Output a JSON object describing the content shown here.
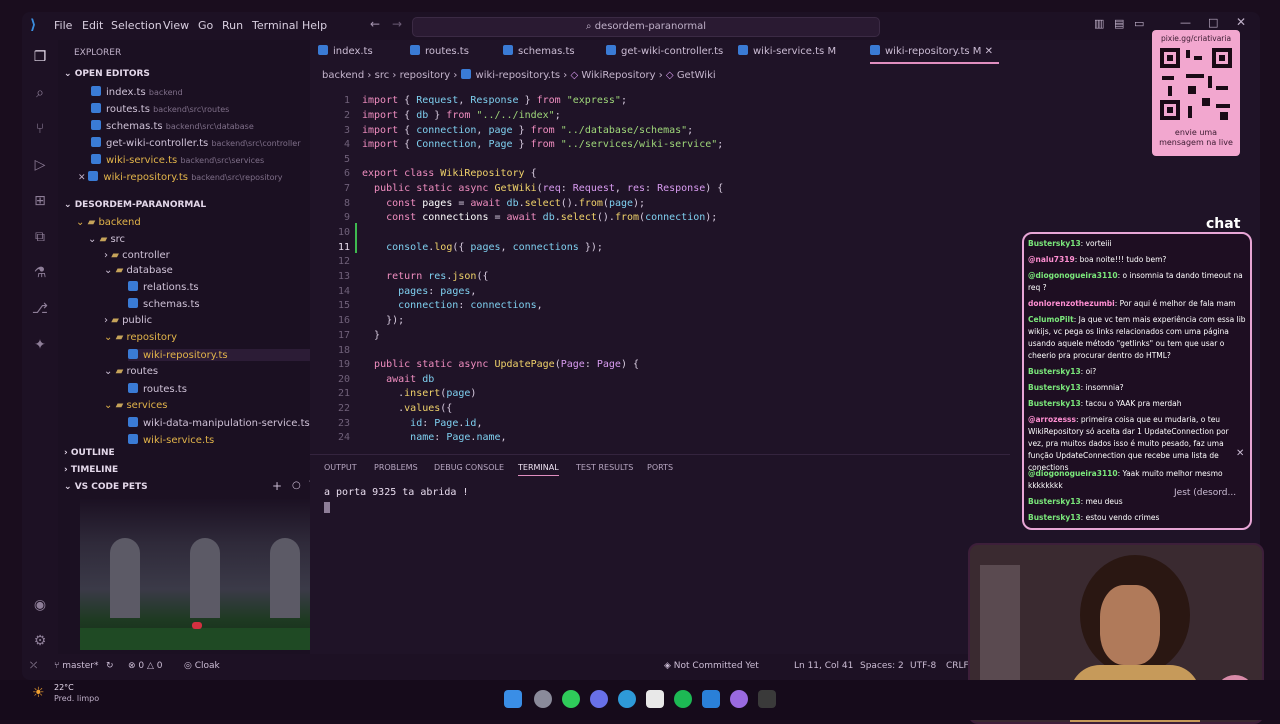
{
  "titlebar": {
    "menus": [
      "File",
      "Edit",
      "Selection",
      "View",
      "Go",
      "Run",
      "Terminal",
      "Help"
    ],
    "search": "desordem-paranormal"
  },
  "sidebar": {
    "title": "EXPLORER",
    "open_editors": "OPEN EDITORS",
    "open_files": [
      {
        "name": "index.ts",
        "path": "backend",
        "mod": ""
      },
      {
        "name": "routes.ts",
        "path": "backend\\src\\routes",
        "mod": ""
      },
      {
        "name": "schemas.ts",
        "path": "backend\\src\\database",
        "mod": ""
      },
      {
        "name": "get-wiki-controller.ts",
        "path": "backend\\src\\controller",
        "mod": ""
      },
      {
        "name": "wiki-service.ts",
        "path": "backend\\src\\services",
        "mod": "M"
      },
      {
        "name": "wiki-repository.ts",
        "path": "backend\\src\\repository",
        "mod": "M"
      }
    ],
    "project": "DESORDEM-PARANORMAL",
    "tree": [
      "backend",
      "src",
      "controller",
      "database",
      "relations.ts",
      "schemas.ts",
      "public",
      "repository",
      "wiki-repository.ts",
      "routes",
      "routes.ts",
      "services",
      "wiki-data-manipulation-service.ts",
      "wiki-service.ts"
    ],
    "outline": "OUTLINE",
    "timeline": "TIMELINE",
    "pets": "VS CODE PETS"
  },
  "tabs": [
    "index.ts",
    "routes.ts",
    "schemas.ts",
    "get-wiki-controller.ts",
    "wiki-service.ts",
    "wiki-repository.ts"
  ],
  "tab_mods": [
    "",
    "",
    "",
    "",
    "M",
    "M"
  ],
  "breadcrumb": [
    "backend",
    "src",
    "repository",
    "wiki-repository.ts",
    "WikiRepository",
    "GetWiki"
  ],
  "code_lines": [
    "1",
    "2",
    "3",
    "4",
    "5",
    "6",
    "7",
    "8",
    "9",
    "10",
    "11",
    "12",
    "13",
    "14",
    "15",
    "16",
    "17",
    "18",
    "19",
    "20",
    "21",
    "22",
    "23",
    "24"
  ],
  "panel": {
    "tabs": [
      "OUTPUT",
      "PROBLEMS",
      "DEBUG CONSOLE",
      "TERMINAL",
      "TEST RESULTS",
      "PORTS"
    ],
    "terminal_line": "a porta 9325 ta abrida !"
  },
  "status": {
    "branch": "master*",
    "errors": "0",
    "warnings": "0",
    "cloak": "Cloak",
    "commit": "Not Committed Yet",
    "position": "Ln 11, Col 41",
    "spaces": "Spaces: 2",
    "encoding": "UTF-8",
    "eol": "CRLF"
  },
  "overlay": {
    "qr_url": "pixie.gg/criativaria",
    "qr_caption": "envie uma mensagem na live",
    "chat_title": "chat",
    "messages": [
      {
        "user": "Bustersky13",
        "text": "vorteiii",
        "c": "g"
      },
      {
        "user": "@nalu7319",
        "text": "boa noite!!! tudo bem?",
        "c": "p"
      },
      {
        "user": "@diogonogueira3110",
        "text": "o insomnia ta dando timeout na req ?",
        "c": "g"
      },
      {
        "user": "donlorenzothezumbi",
        "text": "Por aqui é melhor de fala mam",
        "c": "p"
      },
      {
        "user": "CelumoPilt",
        "text": "Ja que vc tem mais experiência com essa lib wikijs, vc pega os links relacionados com uma página usando aquele método \"getlinks\" ou tem que usar o cheerio pra procurar dentro do HTML?",
        "c": "g"
      },
      {
        "user": "Bustersky13",
        "text": "oi?",
        "c": "g"
      },
      {
        "user": "Bustersky13",
        "text": "insomnia?",
        "c": "g"
      },
      {
        "user": "Bustersky13",
        "text": "tacou o YAAK pra merdah",
        "c": "g"
      },
      {
        "user": "@arrozesss",
        "text": "primeira coisa que eu mudaria, o teu WikiRepository só aceita dar 1 UpdateConnection por vez, pra muitos dados isso é muito pesado, faz uma função UpdateConnection que recebe uma lista de conections",
        "c": "p"
      },
      {
        "user": "@diogonogueira3110",
        "text": "Yaak muito melhor mesmo kkkkkkkk",
        "c": "g"
      },
      {
        "user": "Bustersky13",
        "text": "meu deus",
        "c": "g"
      },
      {
        "user": "Bustersky13",
        "text": "estou vendo crimes",
        "c": "g"
      }
    ],
    "jest": "Jest (desord..."
  },
  "taskbar": {
    "temp": "22°C",
    "weather": "Pred. limpo"
  }
}
